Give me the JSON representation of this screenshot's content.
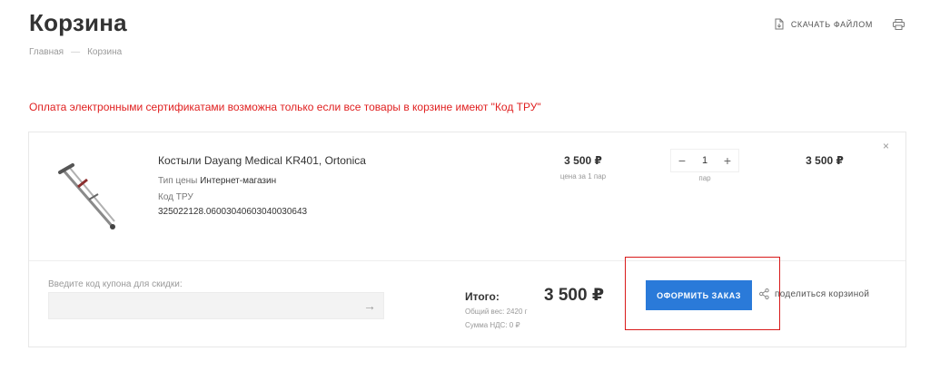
{
  "page": {
    "title": "Корзина",
    "breadcrumb": [
      "Главная",
      "Корзина"
    ]
  },
  "header_actions": {
    "download_label": "СКАЧАТЬ ФАЙЛОМ",
    "download_icon": "file-download-icon",
    "print_icon": "printer-icon"
  },
  "notice": "Оплата электронными сертификатами возможна только если все товары в корзине имеют \"Код ТРУ\"",
  "item": {
    "name": "Костыли Dayang Medical KR401, Ortonica",
    "price_type_label": "Тип цены",
    "price_type_value": "Интернет-магазин",
    "code_label": "Код ТРУ",
    "code_value": "325022128.06003040603040030643",
    "price": "3 500 ₽",
    "price_note": "цена за 1 пар",
    "quantity": "1",
    "quantity_unit": "пар",
    "sum": "3 500 ₽",
    "remove_symbol": "×",
    "image_icon": "crutch-image"
  },
  "coupon": {
    "label": "Введите код купона для скидки:",
    "placeholder": "",
    "submit_symbol": "→"
  },
  "totals": {
    "label": "Итого:",
    "value": "3 500 ₽",
    "weight": "Общий вес: 2420 г",
    "vat": "Сумма НДС: 0 ₽"
  },
  "checkout_label": "ОФОРМИТЬ ЗАКАЗ",
  "share_label": "поделиться корзиной",
  "colors": {
    "accent": "#2a7ad9",
    "notice": "#e02020",
    "highlight": "#d91a1a"
  }
}
